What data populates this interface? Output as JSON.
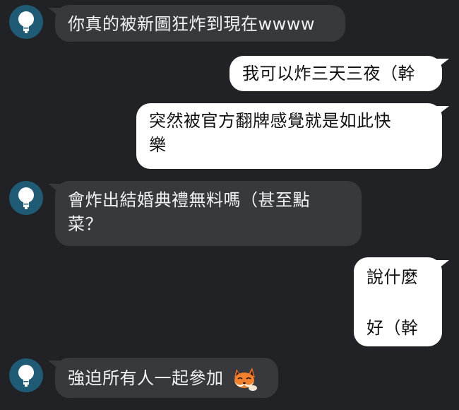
{
  "chat": {
    "messages": [
      {
        "side": "in",
        "lines": [
          "你真的被新圖狂炸到現在wwww"
        ]
      },
      {
        "side": "out",
        "lines": [
          "我可以炸三天三夜（幹"
        ]
      },
      {
        "side": "out",
        "lines": [
          "突然被官方翻牌感覺就是如此快",
          "樂"
        ]
      },
      {
        "side": "in",
        "lines": [
          "會炸出結婚典禮無料嗎（甚至點",
          "菜？"
        ]
      },
      {
        "side": "out",
        "lines": [
          "說什麼",
          "好（幹"
        ]
      },
      {
        "side": "in",
        "lines": [
          "強迫所有人一起參加"
        ],
        "sticker": "fox-emoji-icon"
      }
    ]
  },
  "colors": {
    "background": "#202225",
    "incoming_bubble": "#37393d",
    "outgoing_bubble": "#ffffff",
    "avatar_bg": "#1f5b75",
    "avatar_bulb": "#ffffff"
  }
}
